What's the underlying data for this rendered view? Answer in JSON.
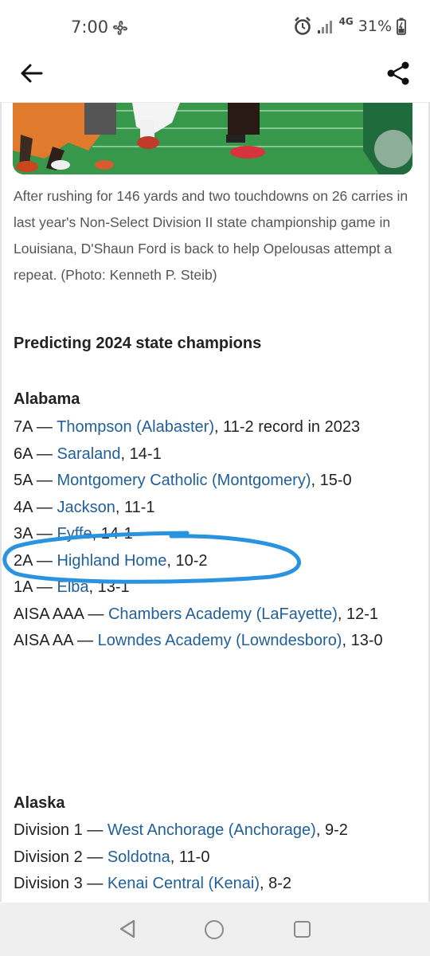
{
  "status_bar": {
    "time": "7:00",
    "network": "4G",
    "battery": "31%"
  },
  "app_bar": {
    "back_icon": "arrow-left-icon",
    "share_icon": "share-icon"
  },
  "article": {
    "caption": "After rushing for 146 yards and two touchdowns on 26 carries in last year's Non-Select Division II state championship game in Louisiana, D'Shaun Ford is back to help Opelousas attempt a repeat. (Photo: Kenneth P. Steib)",
    "section_title": "Predicting 2024 state champions",
    "states": [
      {
        "name": "Alabama",
        "rows": [
          {
            "division": "7A — ",
            "team": "Thompson (Alabaster)",
            "record": ", 11-2 record in 2023"
          },
          {
            "division": "6A — ",
            "team": "Saraland",
            "record": ", 14-1"
          },
          {
            "division": "5A — ",
            "team": "Montgomery Catholic (Montgomery)",
            "record": ", 15-0"
          },
          {
            "division": "4A — ",
            "team": "Jackson",
            "record": ", 11-1"
          },
          {
            "division": "3A — ",
            "team": "Fyffe",
            "record": ", 14-1"
          },
          {
            "division": "2A — ",
            "team": "Highland Home",
            "record": ", 10-2"
          },
          {
            "division": "1A — ",
            "team": "Elba",
            "record": ", 13-1"
          },
          {
            "division": "AISA AAA — ",
            "team": "Chambers Academy (LaFayette)",
            "record": ", 12-1"
          },
          {
            "division": "AISA AA — ",
            "team": "Lowndes Academy (Lowndesboro)",
            "record": ", 13-0"
          }
        ]
      },
      {
        "name": "Alaska",
        "rows": [
          {
            "division": "Division 1 — ",
            "team": "West Anchorage (Anchorage)",
            "record": ", 9-2"
          },
          {
            "division": "Division 2 — ",
            "team": "Soldotna",
            "record": ", 11-0"
          },
          {
            "division": "Division 3 — ",
            "team": "Kenai Central (Kenai)",
            "record": ", 8-2"
          }
        ]
      }
    ]
  },
  "colors": {
    "link": "#21609a",
    "highlight_annotation": "#2a93df",
    "nav_bar": "#efefef"
  }
}
